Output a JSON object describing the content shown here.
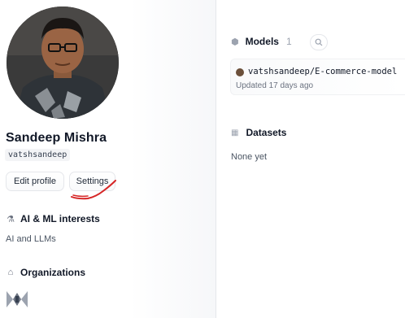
{
  "profile": {
    "name": "Sandeep Mishra",
    "username": "vatshsandeep",
    "edit_profile_label": "Edit profile",
    "settings_label": "Settings"
  },
  "interests": {
    "title": "AI & ML interests",
    "icon": "flask-icon",
    "text": "AI and LLMs"
  },
  "organizations": {
    "title": "Organizations",
    "icon": "building-icon"
  },
  "models": {
    "title": "Models",
    "count": "1",
    "icon": "cube-icon",
    "items": [
      {
        "name": "vatshsandeep/E-commerce-model",
        "updated": "Updated 17 days ago"
      }
    ]
  },
  "datasets": {
    "title": "Datasets",
    "icon": "database-icon",
    "empty_text": "None yet"
  },
  "colors": {
    "annotation": "#d62626",
    "divider": "#e5e7eb"
  }
}
